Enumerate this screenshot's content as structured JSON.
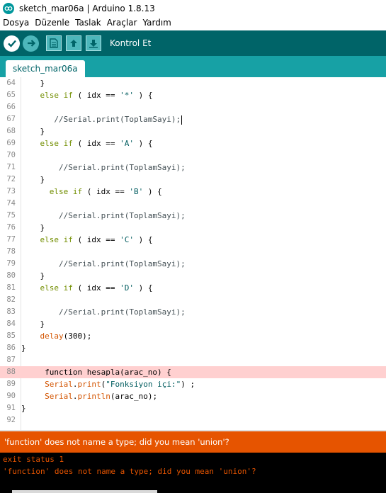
{
  "window": {
    "title": "sketch_mar06a | Arduino 1.8.13"
  },
  "menu": [
    "Dosya",
    "Düzenle",
    "Taslak",
    "Araçlar",
    "Yardım"
  ],
  "toolbar": {
    "buttons": [
      "verify-icon",
      "upload-icon",
      "new-icon",
      "open-icon",
      "save-icon"
    ],
    "status_label": "Kontrol Et"
  },
  "tab": {
    "label": "sketch_mar06a"
  },
  "colors": {
    "toolbar": "#006468",
    "tabstrip": "#17a1a5",
    "error": "#e65400",
    "console": "#000000",
    "highlight": "#ffd0d0"
  },
  "code_lines": [
    {
      "n": "64",
      "text": "    }"
    },
    {
      "n": "65",
      "text": "    else if ( idx == '*' ) {"
    },
    {
      "n": "66",
      "text": ""
    },
    {
      "n": "67",
      "text": "       //Serial.print(ToplamSayi);"
    },
    {
      "n": "68",
      "text": "    }"
    },
    {
      "n": "69",
      "text": "    else if ( idx == 'A' ) {"
    },
    {
      "n": "70",
      "text": ""
    },
    {
      "n": "71",
      "text": "        //Serial.print(ToplamSayi);"
    },
    {
      "n": "72",
      "text": "    }"
    },
    {
      "n": "73",
      "text": "      else if ( idx == 'B' ) {"
    },
    {
      "n": "74",
      "text": ""
    },
    {
      "n": "75",
      "text": "        //Serial.print(ToplamSayi);"
    },
    {
      "n": "76",
      "text": "    }"
    },
    {
      "n": "77",
      "text": "    else if ( idx == 'C' ) {"
    },
    {
      "n": "78",
      "text": ""
    },
    {
      "n": "79",
      "text": "        //Serial.print(ToplamSayi);"
    },
    {
      "n": "80",
      "text": "    }"
    },
    {
      "n": "81",
      "text": "    else if ( idx == 'D' ) {"
    },
    {
      "n": "82",
      "text": ""
    },
    {
      "n": "83",
      "text": "        //Serial.print(ToplamSayi);"
    },
    {
      "n": "84",
      "text": "    }"
    },
    {
      "n": "85",
      "text": "    delay(300);"
    },
    {
      "n": "86",
      "text": "}"
    },
    {
      "n": "87",
      "text": ""
    },
    {
      "n": "88",
      "text": "     function hesapla(arac_no) {"
    },
    {
      "n": "89",
      "text": "     Serial.print(\"Fonksiyon içi:\") ;"
    },
    {
      "n": "90",
      "text": "     Serial.println(arac_no);"
    },
    {
      "n": "91",
      "text": "}"
    },
    {
      "n": "92",
      "text": ""
    }
  ],
  "highlight_line": "88",
  "error_message": "'function' does not name a type; did you mean 'union'?",
  "console": [
    "exit status 1",
    "'function' does not name a type; did you mean 'union'?"
  ]
}
